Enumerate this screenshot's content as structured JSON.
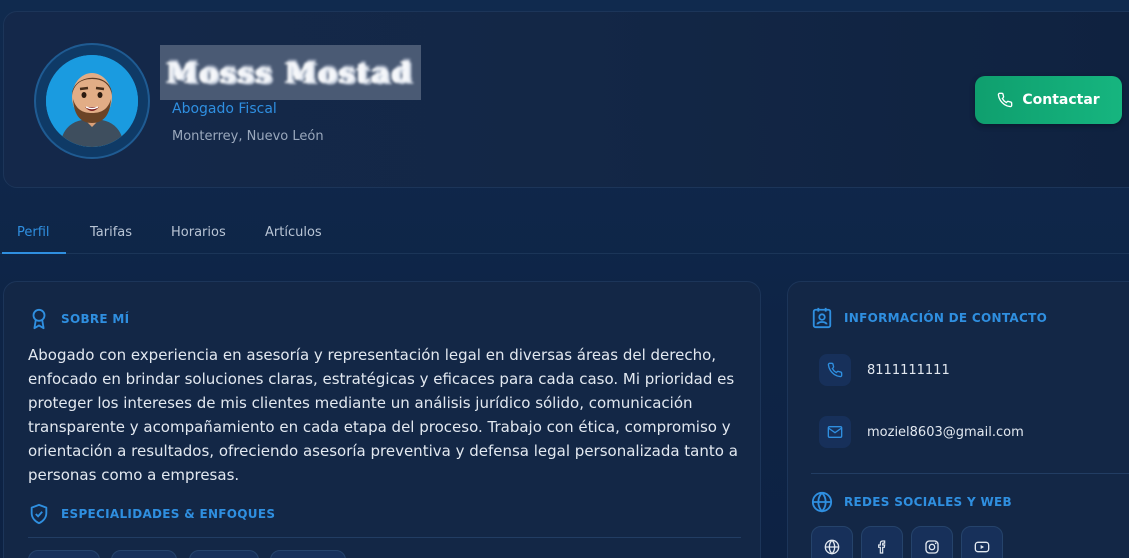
{
  "profile": {
    "name_blurred": "Mosss Mostad",
    "title": "Abogado Fiscal",
    "location": "Monterrey, Nuevo León",
    "contact_button": "Contactar"
  },
  "tabs": [
    {
      "label": "Perfil",
      "active": true
    },
    {
      "label": "Tarifas",
      "active": false
    },
    {
      "label": "Horarios",
      "active": false
    },
    {
      "label": "Artículos",
      "active": false
    }
  ],
  "about": {
    "title": "SOBRE MÍ",
    "text": "Abogado con experiencia en asesoría y representación legal en diversas áreas del derecho, enfocado en brindar soluciones claras, estratégicas y eficaces para cada caso. Mi prioridad es proteger los intereses de mis clientes mediante un análisis jurídico sólido, comunicación transparente y acompañamiento en cada etapa del proceso. Trabajo con ética, compromiso y orientación a resultados, ofreciendo asesoría preventiva y defensa legal personalizada tanto a personas como a empresas.",
    "specialties_title": "ESPECIALIDADES & ENFOQUES"
  },
  "contact": {
    "title": "INFORMACIÓN DE CONTACTO",
    "phone": "8111111111",
    "email": "moziel8603@gmail.com",
    "social_title": "REDES SOCIALES Y WEB"
  },
  "colors": {
    "accent": "#2f8fe0",
    "button": "#16b57f",
    "background": "#0f2444",
    "card": "#132746"
  }
}
